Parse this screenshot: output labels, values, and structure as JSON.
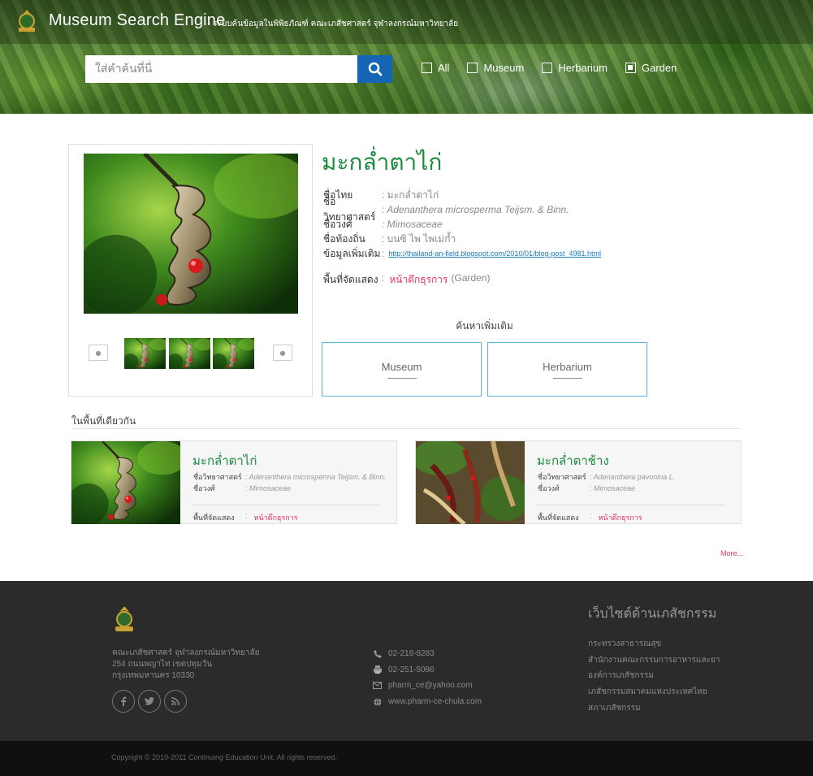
{
  "header": {
    "title": "Museum Search Engine",
    "subtitle": "- ระบบค้นข้อมูลในพิพิธภัณฑ์ คณะเภสัชศาสตร์ จุฬาลงกรณ์มหาวิทยาลัย",
    "search_placeholder": "ใส่คำค้นที่นี่",
    "filters": [
      {
        "label": "All",
        "checked": false
      },
      {
        "label": "Museum",
        "checked": false
      },
      {
        "label": "Herbarium",
        "checked": false
      },
      {
        "label": "Garden",
        "checked": true
      }
    ]
  },
  "item": {
    "title": "มะกล่ำตาไก่",
    "fields": [
      {
        "label": "ชื่อไทย",
        "value": ": มะกล่ำตาไก่"
      },
      {
        "label": "ชื่อวิทยาศาสตร์",
        "value": ": Adenanthera microsperma Teijsm. & Binn."
      },
      {
        "label": "ชื่อวงศ์",
        "value": ": Mimosaceae"
      },
      {
        "label": "ชื่อท้องถิ่น",
        "value": ": บนซิ ไพ ไพเม่ก้ำ"
      },
      {
        "label": "ข้อมูลเพิ่มเติม",
        "sep": ":",
        "value": "http://thailand-an-field.blogspot.com/2010/01/blog-post_4981.html"
      }
    ],
    "display_area_label": "พื้นที่จัดแสดง",
    "display_area_sep": ":",
    "display_area_value": "หน้าตึกธุรการ",
    "display_area_type": "(Garden)"
  },
  "more_search": {
    "title": "ค้นหาเพิ่มเติม",
    "buttons": [
      "Museum",
      "Herbarium"
    ]
  },
  "related": {
    "title": "ในพื้นที่เดียวกัน",
    "cards": [
      {
        "title": "มะกล่ำตาไก่",
        "sci_label": "ชื่อวิทยาศาสตร์",
        "sci_value": ":   Adenanthera microsperma Teijsm. & Binn.",
        "family_label": "ชื่อวงศ์",
        "family_value": ":   Mimosaceae",
        "display_label": "พื้นที่จัดแสดง",
        "display_sep": ":",
        "display_value": "หน้าตึกธุรการ"
      },
      {
        "title": "มะกล่ำตาช้าง",
        "sci_label": "ชื่อวิทยาศาสตร์",
        "sci_value": ":   Adenanthera pavonina L.",
        "family_label": "ชื่อวงศ์",
        "family_value": ":   Mimosaceae",
        "display_label": "พื้นที่จัดแสดง",
        "display_sep": ":",
        "display_value": "หน้าตึกธุรการ"
      }
    ],
    "more_label": "More..."
  },
  "footer": {
    "address": "คณะเภสัชศาสตร์ จุฬาลงกรณ์มหาวิทยาลัย 254 ถนนพญาไท เขตปทุมวัน กรุงเทพมหานคร 10330",
    "contacts": [
      {
        "icon": "phone-icon",
        "text": "02-218-8283"
      },
      {
        "icon": "fax-icon",
        "text": "02-251-5086"
      },
      {
        "icon": "mail-icon",
        "text": "pharm_ce@yahoo.com"
      },
      {
        "icon": "globe-icon",
        "text": "www.pharm-ce-chula.com"
      }
    ],
    "links_title": "เว็บไซต์ด้านเภสัชกรรม",
    "links": [
      "กระทรวงสาธารณสุข",
      "สำนักงานคณะกรรมการอาหารและยา",
      "องค์การเภสัชกรรม",
      "เภสัชกรรมสมาคมแห่งประเทศไทย",
      "สภาเภสัชกรรม"
    ],
    "copyright": "Copyright © 2010-2011 Continuing Education Unit. All rights reserved."
  },
  "colors": {
    "accent_green": "#1a8a3e",
    "accent_pink": "#e8335e",
    "search_blue": "#1565b5",
    "box_border_blue": "#5ab5dc",
    "footer_bg": "#2b2b2b"
  }
}
